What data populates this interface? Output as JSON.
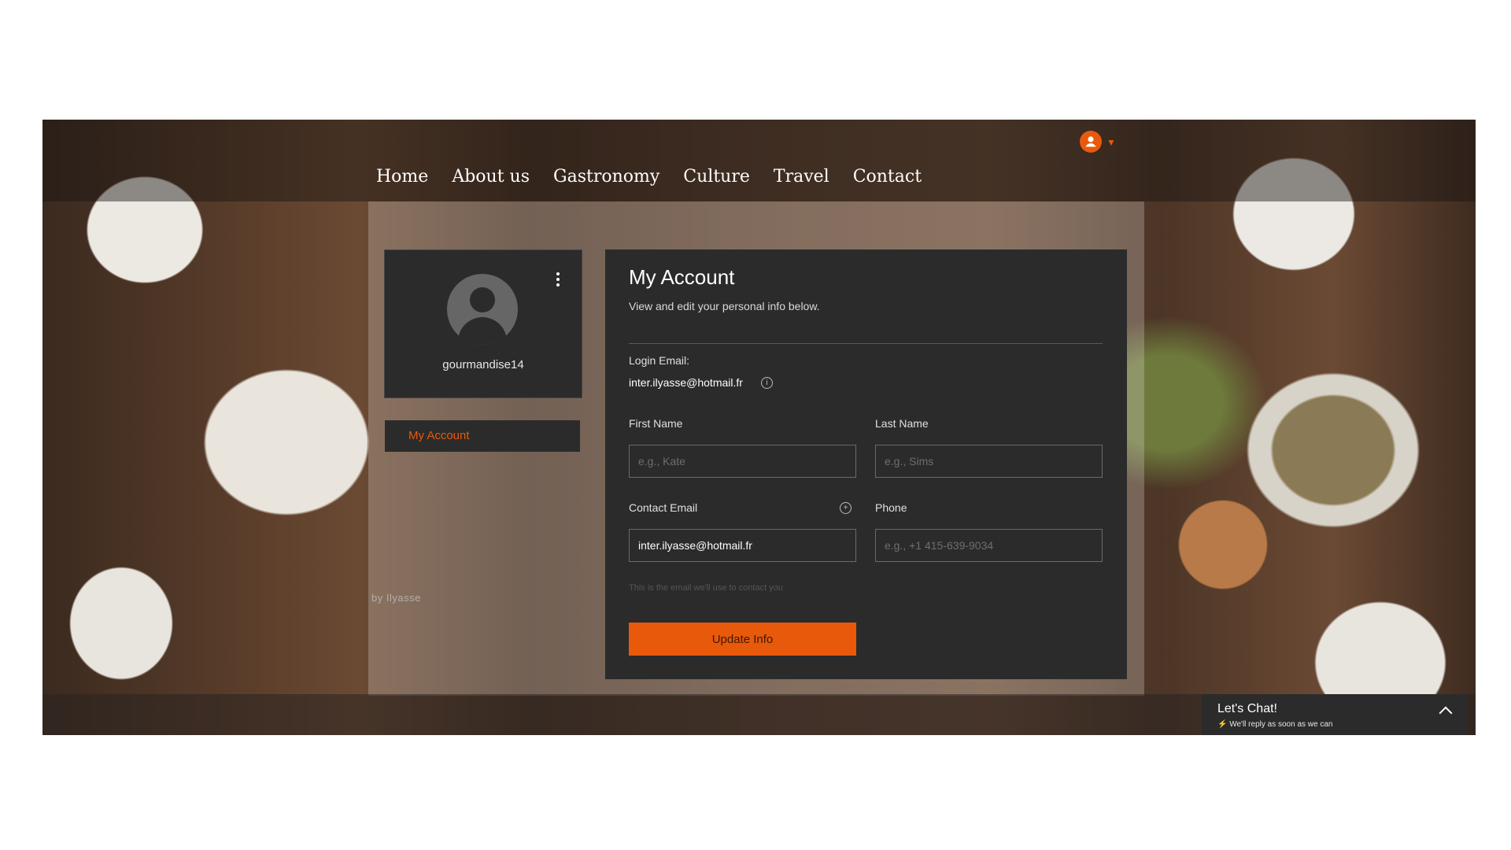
{
  "nav": {
    "items": [
      "Home",
      "About us",
      "Gastronomy",
      "Culture",
      "Travel",
      "Contact"
    ]
  },
  "header": {
    "user_icon": "user-avatar-icon",
    "accent": "#e8590c"
  },
  "profile": {
    "username": "gourmandise14",
    "menu_icon": "kebab-menu-icon"
  },
  "sidebar": {
    "items": [
      {
        "label": "My Account",
        "active": true
      }
    ]
  },
  "account": {
    "title": "My Account",
    "subtitle": "View and edit your personal info below.",
    "login_email_label": "Login Email:",
    "login_email_value": "inter.ilyasse@hotmail.fr",
    "first_name_label": "First Name",
    "first_name_placeholder": "e.g., Kate",
    "last_name_label": "Last Name",
    "last_name_placeholder": "e.g., Sims",
    "contact_email_label": "Contact Email",
    "contact_email_value": "inter.ilyasse@hotmail.fr",
    "contact_email_helper": "This is the email we'll use to contact you",
    "phone_label": "Phone",
    "phone_placeholder": "e.g., +1 415-639-9034",
    "update_button": "Update Info"
  },
  "footer": {
    "credit": "by Ilyasse"
  },
  "chat": {
    "title": "Let's Chat!",
    "subtitle": "We'll reply as soon as we can"
  },
  "colors": {
    "panel": "#2b2b2b",
    "accent": "#e8590c",
    "text": "#ffffff"
  }
}
